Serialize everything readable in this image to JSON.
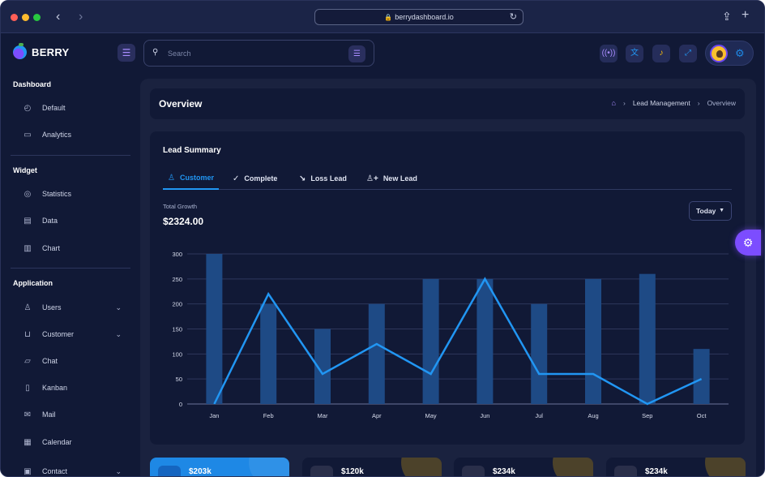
{
  "browser": {
    "url": "berrydashboard.io"
  },
  "app": {
    "name": "BERRY"
  },
  "search": {
    "placeholder": "Search"
  },
  "sidebar": {
    "sections": [
      {
        "title": "Dashboard",
        "items": [
          {
            "label": "Default",
            "icon": "dashboard-icon"
          },
          {
            "label": "Analytics",
            "icon": "device-analytics-icon"
          }
        ]
      },
      {
        "title": "Widget",
        "items": [
          {
            "label": "Statistics",
            "icon": "chart-arcs-icon"
          },
          {
            "label": "Data",
            "icon": "clipboard-list-icon"
          },
          {
            "label": "Chart",
            "icon": "graph-icon"
          }
        ]
      },
      {
        "title": "Application",
        "items": [
          {
            "label": "Users",
            "icon": "user-check-icon"
          },
          {
            "label": "Customer",
            "icon": "basket-icon"
          },
          {
            "label": "Chat",
            "icon": "messages-icon"
          },
          {
            "label": "Kanban",
            "icon": "layout-kanban-icon"
          },
          {
            "label": "Mail",
            "icon": "mail-icon"
          },
          {
            "label": "Calendar",
            "icon": "calendar-icon"
          },
          {
            "label": "Contact",
            "icon": "contact-icon"
          }
        ]
      }
    ]
  },
  "page": {
    "title": "Overview",
    "breadcrumb": [
      "Lead Management",
      "Overview"
    ]
  },
  "lead_summary": {
    "title": "Lead Summary",
    "tabs": [
      "Customer",
      "Complete",
      "Loss Lead",
      "New Lead"
    ],
    "active_tab": "Customer",
    "growth_label": "Total Growth",
    "growth_value": "$2324.00",
    "period": "Today"
  },
  "chart_data": {
    "type": "bar",
    "categories": [
      "Jan",
      "Feb",
      "Mar",
      "Apr",
      "May",
      "Jun",
      "Jul",
      "Aug",
      "Sep",
      "Oct"
    ],
    "series": [
      {
        "type": "bar",
        "values": [
          300,
          200,
          150,
          200,
          250,
          250,
          200,
          250,
          260,
          110
        ]
      },
      {
        "type": "line",
        "values": [
          0,
          220,
          60,
          120,
          60,
          250,
          60,
          60,
          0,
          50
        ]
      }
    ],
    "yticks": [
      0,
      50,
      100,
      150,
      200,
      250,
      300
    ],
    "ylim": [
      0,
      300
    ],
    "grid": true,
    "colors": {
      "bar": "#1e4a85",
      "line": "#2196f3"
    }
  },
  "stats": [
    {
      "value": "$203k",
      "style": "blue"
    },
    {
      "value": "$120k",
      "style": "dark"
    },
    {
      "value": "$234k",
      "style": "dark"
    },
    {
      "value": "$234k",
      "style": "dark"
    }
  ],
  "colors": {
    "primary": "#2196f3",
    "secondary": "#7c4dff",
    "background": "#111936"
  }
}
